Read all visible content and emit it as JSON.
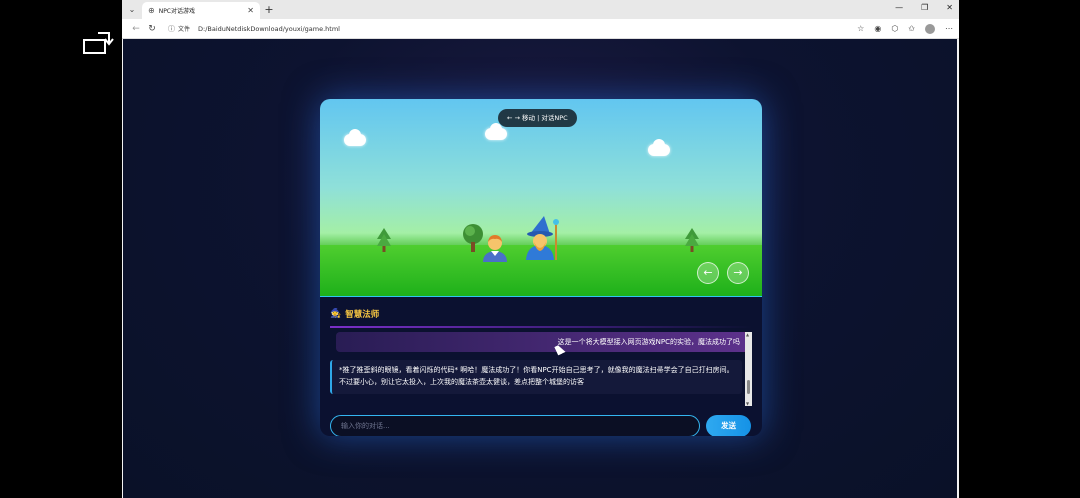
{
  "browser": {
    "tab_title": "NPC对话游戏",
    "address_label": "文件",
    "url": "D:/BaiduNetdiskDownload/youxi/game.html"
  },
  "icons": {
    "rotate": "rotate-screen-icon",
    "tab_favicon": "globe-icon",
    "close_tab": "close-icon",
    "new_tab": "plus-icon",
    "back": "back-arrow-icon",
    "refresh": "refresh-icon",
    "info": "info-icon",
    "favorites": "star-icon",
    "extensions": "puzzle-icon",
    "profile": "avatar-icon",
    "more": "more-icon",
    "player": "boy-player-icon",
    "npc": "wizard-npc-icon"
  },
  "game": {
    "hint": "← → 移动 | 对话NPC",
    "left_button": "←",
    "right_button": "→",
    "npc_name": "智慧法师",
    "npc_badge_icon": "🧙",
    "messages": [
      {
        "role": "user",
        "text": "这是一个将大模型接入网页游戏NPC的实验，魔法成功了吗"
      },
      {
        "role": "npc",
        "text": "*推了推歪斜的眼镜，看着闪烁的代码* 啊哈！魔法成功了！你看NPC开始自己思考了，就像我的魔法扫帚学会了自己打扫房间。不过要小心，别让它太投入，上次我的魔法茶壶太健谈，差点把整个城堡的访客"
      }
    ],
    "input_placeholder": "输入你的对话...",
    "send_label": "发送"
  },
  "colors": {
    "accent": "#2fa9f0",
    "npc_name": "#f5c542",
    "page_bg": "#0d1330"
  }
}
